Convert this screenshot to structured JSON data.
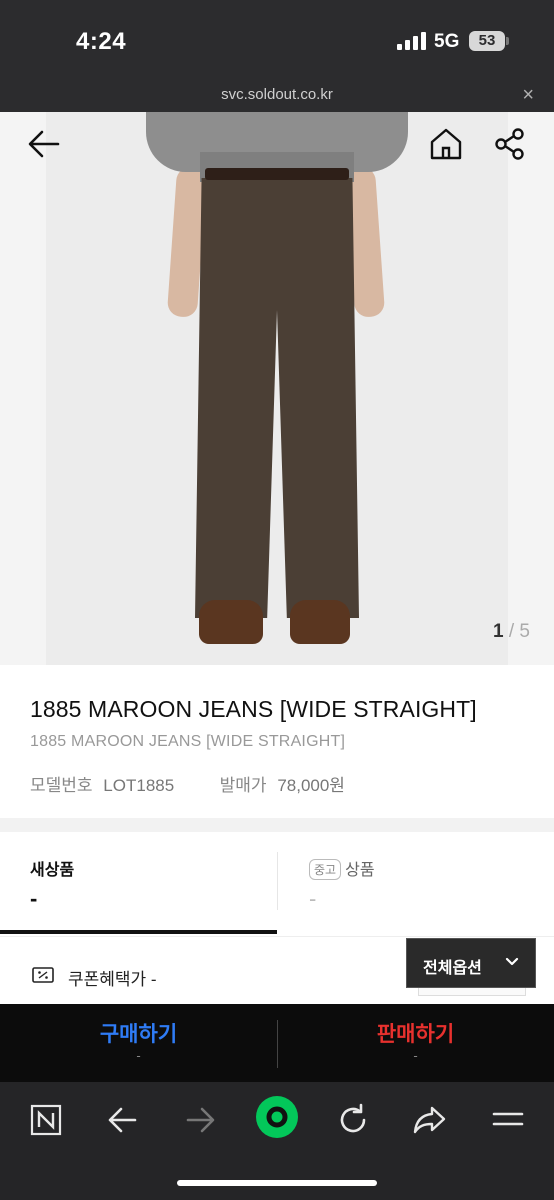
{
  "status_bar": {
    "time": "4:24",
    "network": "5G",
    "battery": "53"
  },
  "browser": {
    "url": "svc.soldout.co.kr",
    "close_glyph": "×"
  },
  "product": {
    "title": "1885 MAROON JEANS [WIDE STRAIGHT]",
    "subtitle": "1885 MAROON JEANS [WIDE STRAIGHT]",
    "model_label": "모델번호",
    "model_value": "LOT1885",
    "release_price_label": "발매가",
    "release_price_value": "78,000원",
    "pager_current": "1",
    "pager_separator": " / ",
    "pager_total": "5"
  },
  "tabs": {
    "new_label": "새상품",
    "new_price": "-",
    "used_badge": "중고",
    "used_label": "상품",
    "used_price": "-"
  },
  "coupon": {
    "label": "쿠폰혜택가 -"
  },
  "options": {
    "label": "전체옵션"
  },
  "actions": {
    "buy_label": "구매하기",
    "buy_sub": "-",
    "sell_label": "판매하기",
    "sell_sub": "-"
  },
  "colors": {
    "buy": "#2f7cf6",
    "sell": "#e8312e",
    "browser_accent": "#03c75a"
  },
  "icons": [
    "back-arrow-icon",
    "home-icon",
    "share-icon",
    "coupon-icon",
    "chevron-down-icon",
    "naver-n-icon",
    "browser-back-icon",
    "browser-forward-icon",
    "green-circle-icon",
    "refresh-icon",
    "share-arrow-icon",
    "menu-icon"
  ]
}
